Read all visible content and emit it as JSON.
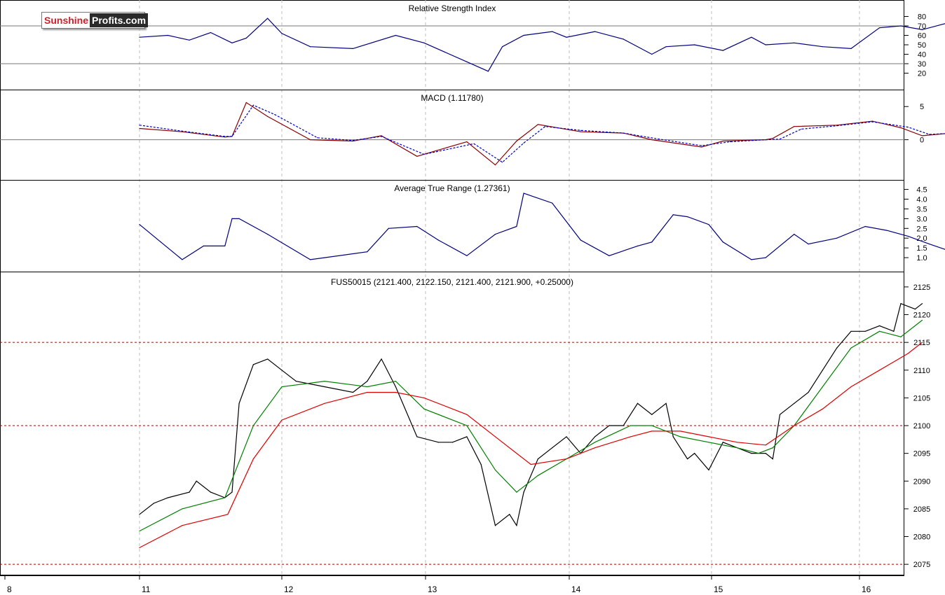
{
  "logo": {
    "part1": "Sunshine",
    "part2": "Profits.com"
  },
  "chart_data": [
    {
      "type": "line",
      "title": "Relative Strength Index",
      "ylim": [
        10,
        90
      ],
      "yticks": [
        20,
        30,
        40,
        50,
        60,
        70,
        80
      ],
      "reference_lines": [
        70,
        30
      ],
      "series": [
        {
          "color": "#000080",
          "x": [
            0,
            0.2,
            0.35,
            0.5,
            0.65,
            0.75,
            0.9,
            1.0,
            1.2,
            1.5,
            1.8,
            2.0,
            2.3,
            2.45,
            2.55,
            2.7,
            2.9,
            3.0,
            3.2,
            3.4,
            3.6,
            3.7,
            3.9,
            4.1,
            4.3,
            4.4,
            4.6,
            4.8,
            5.0,
            5.2,
            5.35,
            5.5,
            5.7,
            5.8,
            6.0,
            6.1,
            6.2,
            6.3,
            6.45,
            6.5
          ],
          "values": [
            58,
            60,
            55,
            63,
            52,
            57,
            78,
            62,
            48,
            46,
            60,
            52,
            32,
            22,
            48,
            60,
            64,
            58,
            64,
            56,
            40,
            48,
            50,
            44,
            58,
            50,
            52,
            48,
            46,
            68,
            70,
            66,
            74,
            70,
            68,
            56,
            48,
            75,
            60,
            64
          ]
        }
      ]
    },
    {
      "type": "line",
      "title": "MACD (1.11780)",
      "ylim": [
        -5,
        6.5
      ],
      "yticks": [
        5,
        0
      ],
      "reference_lines": [
        0
      ],
      "series": [
        {
          "color": "#8b0000",
          "x": [
            0,
            0.3,
            0.6,
            0.65,
            0.75,
            0.9,
            1.2,
            1.5,
            1.7,
            1.95,
            2.3,
            2.5,
            2.65,
            2.8,
            3.1,
            3.4,
            3.6,
            3.95,
            4.1,
            4.4,
            4.45,
            4.6,
            4.9,
            5.15,
            5.35,
            5.5,
            5.75,
            6.0,
            6.2,
            6.3,
            6.5
          ],
          "values": [
            1.7,
            1.2,
            0.4,
            0.5,
            5.6,
            3.5,
            0,
            -0.2,
            0.6,
            -2.5,
            -0.3,
            -3.8,
            -0.2,
            2.3,
            1.2,
            1.0,
            0,
            -1.1,
            -0.2,
            0,
            0.2,
            2.0,
            2.2,
            2.8,
            1.8,
            0.6,
            1.1,
            0.5,
            1.2,
            1.0,
            1.2
          ]
        },
        {
          "color": "#0000cd",
          "x": [
            0,
            0.3,
            0.6,
            0.65,
            0.8,
            0.95,
            1.25,
            1.5,
            1.7,
            2.0,
            2.35,
            2.55,
            2.7,
            2.85,
            3.1,
            3.4,
            3.65,
            3.95,
            4.15,
            4.4,
            4.5,
            4.65,
            4.9,
            5.15,
            5.4,
            5.55,
            5.75,
            6.0,
            6.2,
            6.3,
            6.5
          ],
          "values": [
            2.2,
            1.3,
            0.5,
            0.5,
            5.2,
            3.8,
            0.3,
            -0.1,
            0.5,
            -2.2,
            -0.6,
            -3.4,
            -0.5,
            2.0,
            1.4,
            1.0,
            0.1,
            -0.9,
            -0.3,
            0,
            0.1,
            1.6,
            2.1,
            2.7,
            1.9,
            0.8,
            1.0,
            0.6,
            1.1,
            1.0,
            1.2
          ]
        }
      ]
    },
    {
      "type": "line",
      "title": "Average True Range (1.27361)",
      "ylim": [
        0.5,
        4.7
      ],
      "yticks": [
        1.0,
        1.5,
        2.0,
        2.5,
        3.0,
        3.5,
        4.0,
        4.5
      ],
      "series": [
        {
          "color": "#000080",
          "x": [
            0,
            0.15,
            0.3,
            0.45,
            0.6,
            0.65,
            0.7,
            0.9,
            1.2,
            1.3,
            1.6,
            1.75,
            1.95,
            2.1,
            2.3,
            2.5,
            2.65,
            2.7,
            2.9,
            3.1,
            3.3,
            3.5,
            3.6,
            3.75,
            3.85,
            4.0,
            4.1,
            4.3,
            4.4,
            4.6,
            4.7,
            4.9,
            5.1,
            5.25,
            5.4,
            5.55,
            5.75,
            5.9,
            6.1,
            6.2,
            6.3,
            6.45,
            6.5
          ],
          "values": [
            2.7,
            1.8,
            0.9,
            1.6,
            1.6,
            3.0,
            3.0,
            2.2,
            0.9,
            1.0,
            1.3,
            2.5,
            2.6,
            1.9,
            1.1,
            2.2,
            2.6,
            4.3,
            3.8,
            1.9,
            1.1,
            1.6,
            1.8,
            3.2,
            3.1,
            2.7,
            1.8,
            0.9,
            1.0,
            2.2,
            1.7,
            2.0,
            2.6,
            2.4,
            2.1,
            1.7,
            1.2,
            1.4,
            0.8,
            1.0,
            1.5,
            1.3,
            1.27
          ]
        }
      ]
    },
    {
      "type": "line",
      "title": "FUS50015 (2121.400, 2122.150, 2121.400, 2121.900, +0.25000)",
      "ylim": [
        2073,
        2126.5
      ],
      "yticks": [
        2075,
        2080,
        2085,
        2090,
        2095,
        2100,
        2105,
        2110,
        2115,
        2120,
        2125
      ],
      "reference_lines": [
        2115,
        2100,
        2075
      ],
      "x_tick_labels": [
        "8",
        "11",
        "12",
        "13",
        "14",
        "15",
        "16"
      ],
      "series": [
        {
          "name": "",
          "color": "#000000",
          "x": [
            0,
            0.1,
            0.2,
            0.35,
            0.4,
            0.5,
            0.6,
            0.65,
            0.7,
            0.8,
            0.9,
            1.0,
            1.1,
            1.3,
            1.5,
            1.6,
            1.7,
            1.8,
            1.9,
            1.95,
            2.1,
            2.2,
            2.3,
            2.4,
            2.5,
            2.6,
            2.65,
            2.7,
            2.8,
            2.9,
            3.0,
            3.1,
            3.2,
            3.3,
            3.4,
            3.5,
            3.6,
            3.7,
            3.75,
            3.85,
            3.9,
            4.0,
            4.1,
            4.2,
            4.3,
            4.4,
            4.45,
            4.5,
            4.6,
            4.7,
            4.8,
            4.9,
            5.0,
            5.1,
            5.2,
            5.3,
            5.35,
            5.45,
            5.5
          ],
          "values": [
            2084,
            2086,
            2087,
            2088,
            2090,
            2088,
            2087,
            2088,
            2104,
            2111,
            2112,
            2110,
            2108,
            2107,
            2106,
            2108,
            2112,
            2107,
            2101,
            2098,
            2097,
            2097,
            2098,
            2093,
            2082,
            2084,
            2082,
            2088,
            2094,
            2096,
            2098,
            2095,
            2098,
            2100,
            2100,
            2104,
            2102,
            2104,
            2098,
            2094,
            2095,
            2092,
            2097,
            2096,
            2095,
            2095,
            2094,
            2102,
            2104,
            2106,
            2110,
            2114,
            2117,
            2117,
            2118,
            2117,
            2122,
            2121,
            2122
          ]
        },
        {
          "name": "",
          "color": "#008000",
          "x": [
            0,
            0.3,
            0.6,
            0.8,
            1.0,
            1.3,
            1.6,
            1.8,
            2.0,
            2.3,
            2.5,
            2.65,
            2.8,
            3.0,
            3.2,
            3.45,
            3.6,
            3.8,
            4.0,
            4.2,
            4.35,
            4.45,
            4.6,
            4.8,
            5.0,
            5.2,
            5.35,
            5.5
          ],
          "values": [
            2081,
            2085,
            2087,
            2100,
            2107,
            2108,
            2107,
            2108,
            2103,
            2100,
            2092,
            2088,
            2091,
            2094,
            2097,
            2100,
            2100,
            2098,
            2097,
            2096,
            2095,
            2096,
            2100,
            2107,
            2114,
            2117,
            2116,
            2119
          ]
        },
        {
          "name": "",
          "color": "#e00000",
          "x": [
            0,
            0.3,
            0.62,
            0.8,
            1.0,
            1.3,
            1.6,
            1.8,
            2.0,
            2.3,
            2.55,
            2.75,
            3.0,
            3.2,
            3.45,
            3.6,
            3.8,
            4.0,
            4.2,
            4.4,
            4.6,
            4.8,
            5.0,
            5.2,
            5.4,
            5.5
          ],
          "values": [
            2078,
            2082,
            2084,
            2094,
            2101,
            2104,
            2106,
            2106,
            2105,
            2102,
            2097,
            2093,
            2094,
            2096,
            2098,
            2099,
            2099,
            2098,
            2097,
            2096.5,
            2100,
            2103,
            2107,
            2110,
            2113,
            2115
          ]
        }
      ]
    }
  ]
}
